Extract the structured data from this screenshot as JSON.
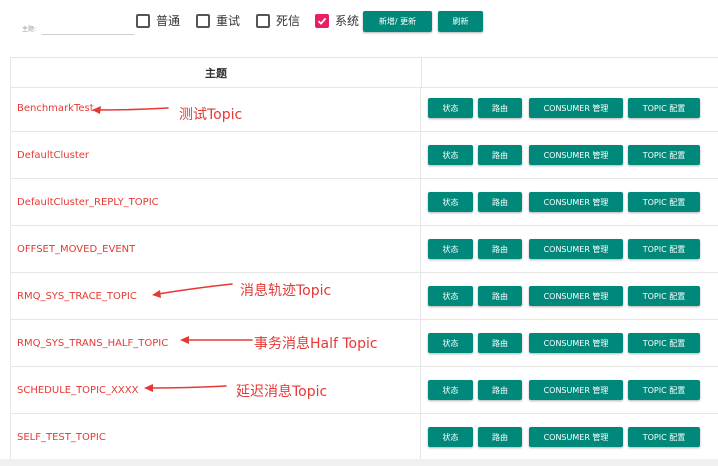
{
  "toolbar": {
    "topic_label": "主题:",
    "topic_input_value": "",
    "checkboxes": [
      {
        "label": "普通",
        "checked": false
      },
      {
        "label": "重试",
        "checked": false
      },
      {
        "label": "死信",
        "checked": false
      },
      {
        "label": "系统",
        "checked": true
      }
    ],
    "add_update_label": "新增/ 更新",
    "refresh_label": "刷新"
  },
  "table": {
    "header": "主题",
    "row_buttons": [
      "状态",
      "路由",
      "CONSUMER 管理",
      "TOPIC 配置"
    ],
    "rows": [
      {
        "name": "BenchmarkTest"
      },
      {
        "name": "DefaultCluster"
      },
      {
        "name": "DefaultCluster_REPLY_TOPIC"
      },
      {
        "name": "OFFSET_MOVED_EVENT"
      },
      {
        "name": "RMQ_SYS_TRACE_TOPIC"
      },
      {
        "name": "RMQ_SYS_TRANS_HALF_TOPIC"
      },
      {
        "name": "SCHEDULE_TOPIC_XXXX"
      },
      {
        "name": "SELF_TEST_TOPIC"
      }
    ]
  },
  "annotations": [
    {
      "text": "测试Topic"
    },
    {
      "text": "消息轨迹Topic"
    },
    {
      "text": "事务消息Half Topic"
    },
    {
      "text": "延迟消息Topic"
    }
  ],
  "colors": {
    "accent": "#00897b",
    "topic_red": "#e53935",
    "checkbox_pink": "#e91e63"
  }
}
